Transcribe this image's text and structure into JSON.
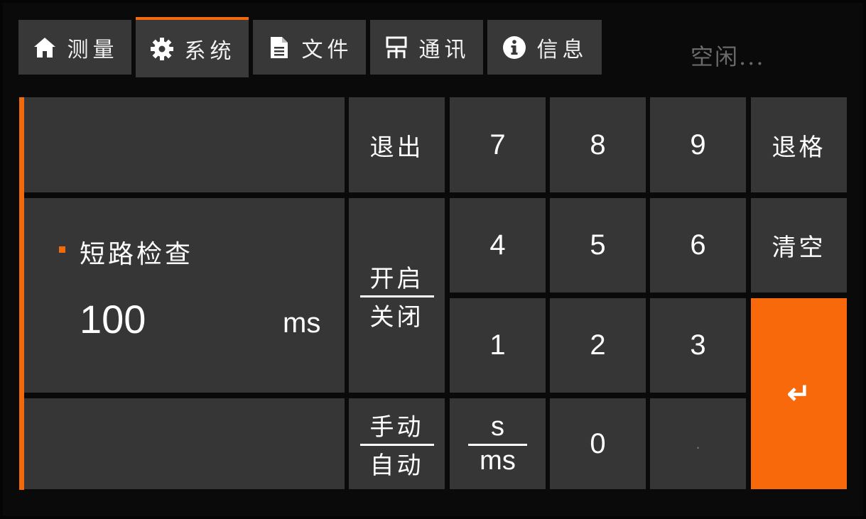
{
  "tabs": [
    {
      "label": "测量",
      "icon": "home-icon"
    },
    {
      "label": "系统",
      "icon": "gear-icon"
    },
    {
      "label": "文件",
      "icon": "document-icon"
    },
    {
      "label": "通讯",
      "icon": "network-icon"
    },
    {
      "label": "信息",
      "icon": "info-icon"
    }
  ],
  "active_tab": "系统",
  "status": "空闲...",
  "field": {
    "label": "短路检查",
    "value": "100",
    "unit": "ms"
  },
  "keys": {
    "exit": "退出",
    "backspace": "退格",
    "clear": "清空",
    "toggle_on": "开启",
    "toggle_off": "关闭",
    "mode_manual": "手动",
    "mode_auto": "自动",
    "unit_s": "s",
    "unit_ms": "ms",
    "dot": ".",
    "enter": "↵",
    "d0": "0",
    "d1": "1",
    "d2": "2",
    "d3": "3",
    "d4": "4",
    "d5": "5",
    "d6": "6",
    "d7": "7",
    "d8": "8",
    "d9": "9"
  },
  "colors": {
    "accent": "#f26a0a",
    "panel": "#363636",
    "background": "#0a0a0a"
  }
}
